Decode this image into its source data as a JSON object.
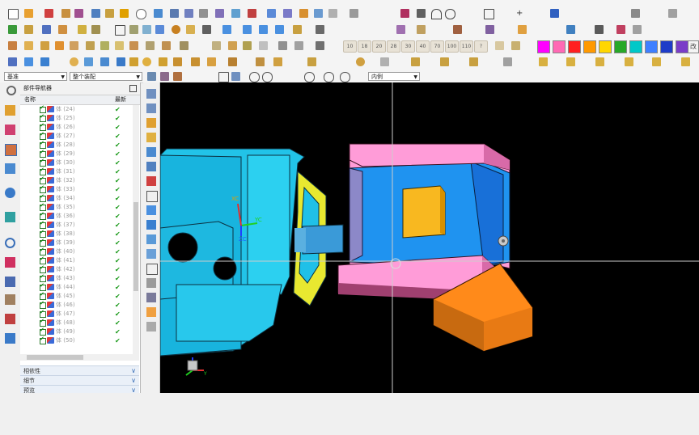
{
  "toolbar": {
    "filter_label": "基准",
    "scope_label": "整个装配",
    "snap_label": "内例",
    "number_buttons": [
      "10",
      "18",
      "20",
      "28",
      "30",
      "40",
      "70",
      "100",
      "110",
      "?"
    ],
    "swatch_colors": [
      "#ff00ff",
      "#ff69b4",
      "#ff2020",
      "#ff9900",
      "#ffd700",
      "#28a828",
      "#00c8c8",
      "#3f7fff",
      "#1e3cc8",
      "#7a3cc8",
      "#b08060"
    ],
    "last_button": "改"
  },
  "navigator": {
    "title": "部件导航器",
    "col_name": "名称",
    "col_latest": "最新",
    "body_label": "体",
    "body_numbers": [
      "(24)",
      "(25)",
      "(26)",
      "(27)",
      "(28)",
      "(29)",
      "(30)",
      "(31)",
      "(32)",
      "(33)",
      "(34)",
      "(35)",
      "(36)",
      "(37)",
      "(38)",
      "(39)",
      "(40)",
      "(41)",
      "(42)",
      "(43)",
      "(44)",
      "(45)",
      "(46)",
      "(47)",
      "(48)",
      "(49)",
      "(50)"
    ],
    "check": "✔",
    "panels": [
      "相依性",
      "细节",
      "预览"
    ]
  },
  "viewport": {
    "wcs_x": "XC",
    "wcs_y": "YC",
    "wcs_z": "ZC",
    "triad_y": "Y"
  }
}
